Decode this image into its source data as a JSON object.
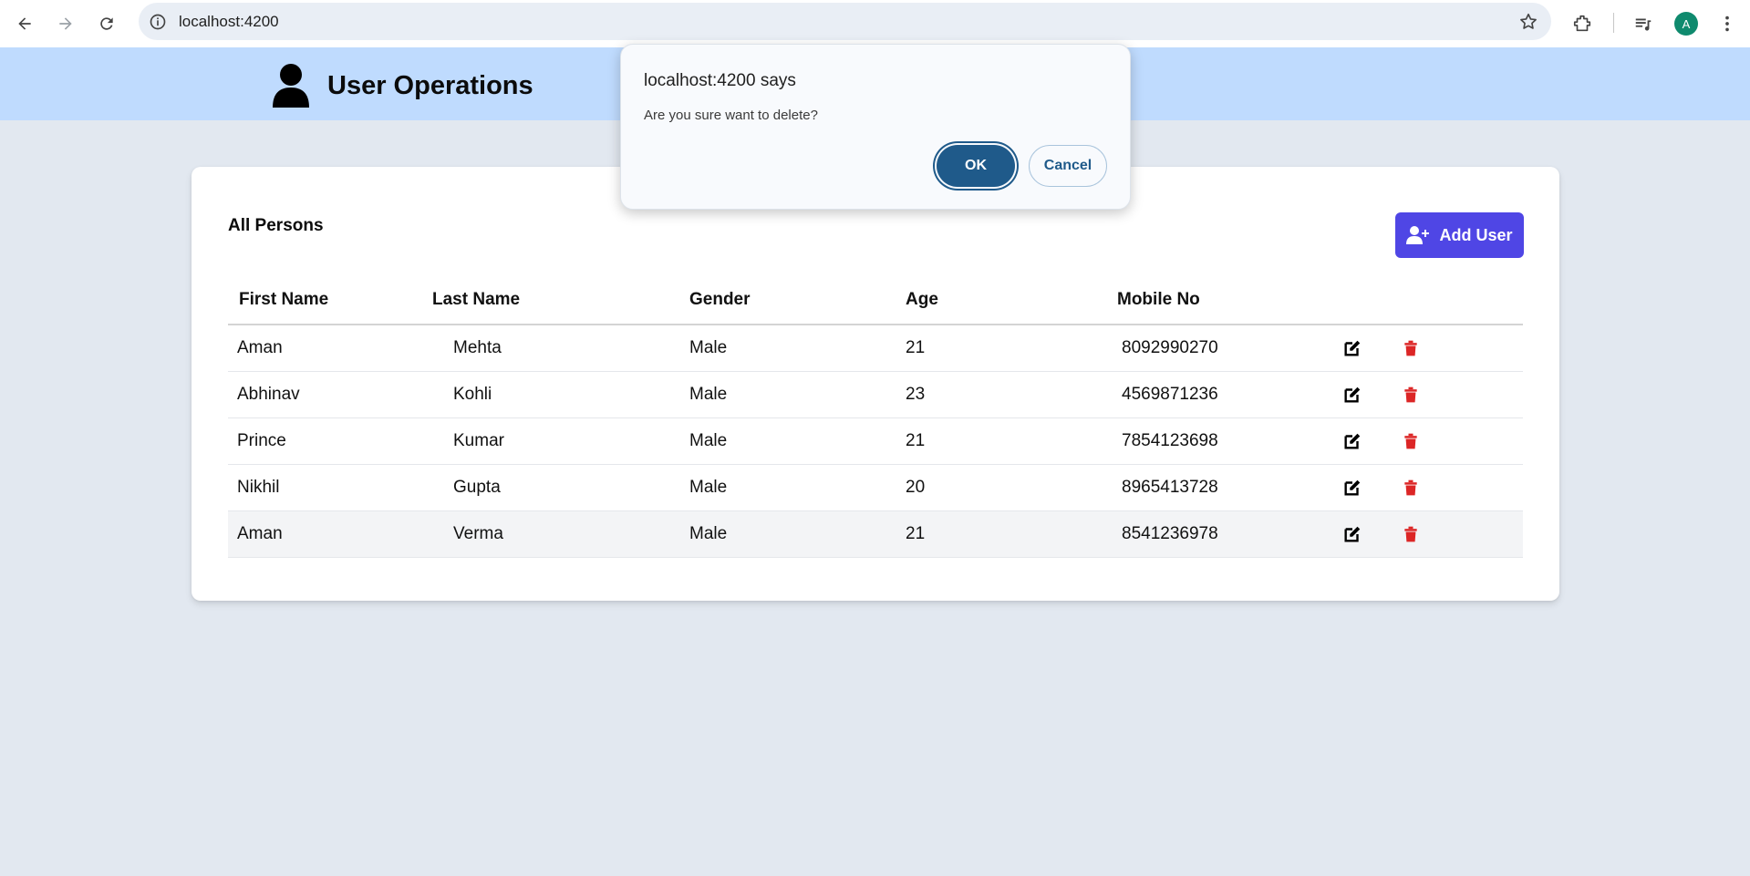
{
  "browser": {
    "url": "localhost:4200",
    "profile_initial": "A",
    "icons": [
      "back-arrow-icon",
      "forward-arrow-icon",
      "reload-icon",
      "site-info-icon",
      "bookmark-star-icon",
      "extensions-icon",
      "media-controls-icon",
      "kebab-menu-icon"
    ]
  },
  "header": {
    "title": "User Operations",
    "icon": "user-icon"
  },
  "card": {
    "title": "All Persons",
    "add_button_label": "Add User",
    "add_button_icon": "user-plus-icon"
  },
  "table": {
    "columns": [
      "First Name",
      "Last Name",
      "Gender",
      "Age",
      "Mobile No"
    ],
    "rows": [
      {
        "first": "Aman",
        "last": "Mehta",
        "gender": "Male",
        "age": "21",
        "mobile": "8092990270"
      },
      {
        "first": "Abhinav",
        "last": "Kohli",
        "gender": "Male",
        "age": "23",
        "mobile": "4569871236"
      },
      {
        "first": "Prince",
        "last": "Kumar",
        "gender": "Male",
        "age": "21",
        "mobile": "7854123698"
      },
      {
        "first": "Nikhil",
        "last": "Gupta",
        "gender": "Male",
        "age": "20",
        "mobile": "8965413728"
      },
      {
        "first": "Aman",
        "last": "Verma",
        "gender": "Male",
        "age": "21",
        "mobile": "8541236978"
      }
    ],
    "row_actions": [
      "edit-icon",
      "trash-icon"
    ]
  },
  "dialog": {
    "title": "localhost:4200 says",
    "message": "Are you sure want to delete?",
    "ok_label": "OK",
    "cancel_label": "Cancel"
  },
  "colors": {
    "header_bg": "#bfdbfe",
    "page_bg": "#e2e8f0",
    "add_button": "#4f46e5",
    "delete_icon": "#dc2626",
    "dialog_primary": "#1f5a8a",
    "highlight_row": "#f3f4f6"
  }
}
